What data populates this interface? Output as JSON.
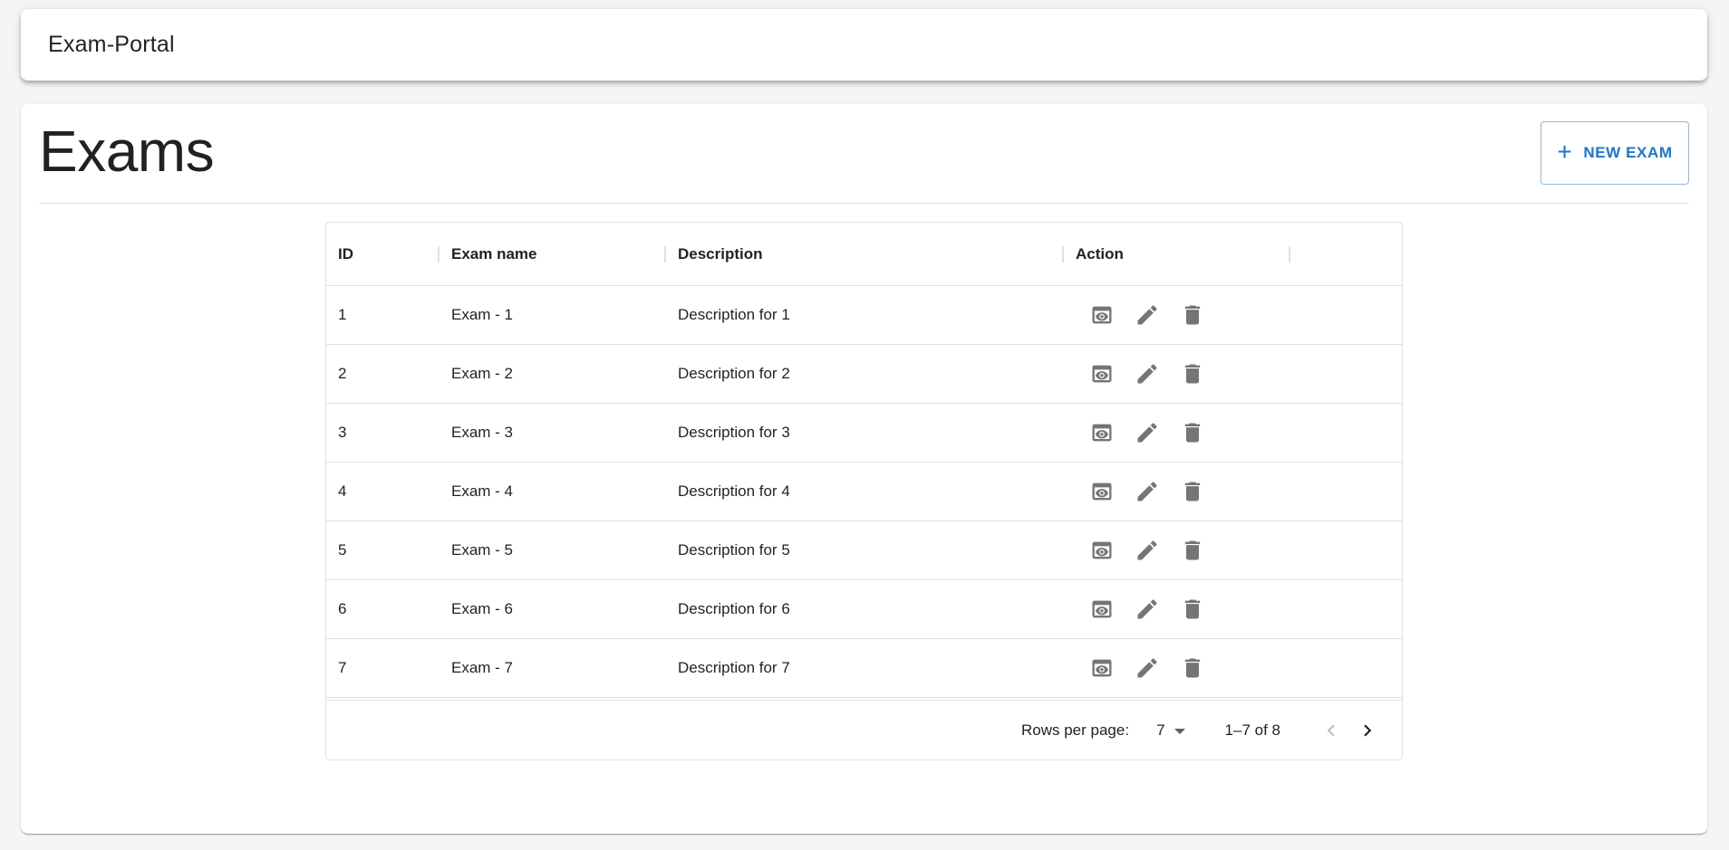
{
  "app": {
    "title": "Exam-Portal"
  },
  "page": {
    "title": "Exams",
    "new_button_label": "NEW EXAM",
    "new_button_icon": "plus-icon"
  },
  "table": {
    "columns": [
      "ID",
      "Exam name",
      "Description",
      "Action"
    ],
    "rows": [
      {
        "id": "1",
        "name": "Exam - 1",
        "description": "Description for 1"
      },
      {
        "id": "2",
        "name": "Exam - 2",
        "description": "Description for 2"
      },
      {
        "id": "3",
        "name": "Exam - 3",
        "description": "Description for 3"
      },
      {
        "id": "4",
        "name": "Exam - 4",
        "description": "Description for 4"
      },
      {
        "id": "5",
        "name": "Exam - 5",
        "description": "Description for 5"
      },
      {
        "id": "6",
        "name": "Exam - 6",
        "description": "Description for 6"
      },
      {
        "id": "7",
        "name": "Exam - 7",
        "description": "Description for 7"
      }
    ],
    "row_action_icons": [
      "view-icon",
      "edit-icon",
      "delete-icon"
    ]
  },
  "pagination": {
    "rows_per_page_label": "Rows per page:",
    "rows_per_page_value": "7",
    "range_label": "1–7 of 8"
  },
  "colors": {
    "primary": "#1976d2",
    "icon": "#757575",
    "background": "#f5f5f5"
  }
}
